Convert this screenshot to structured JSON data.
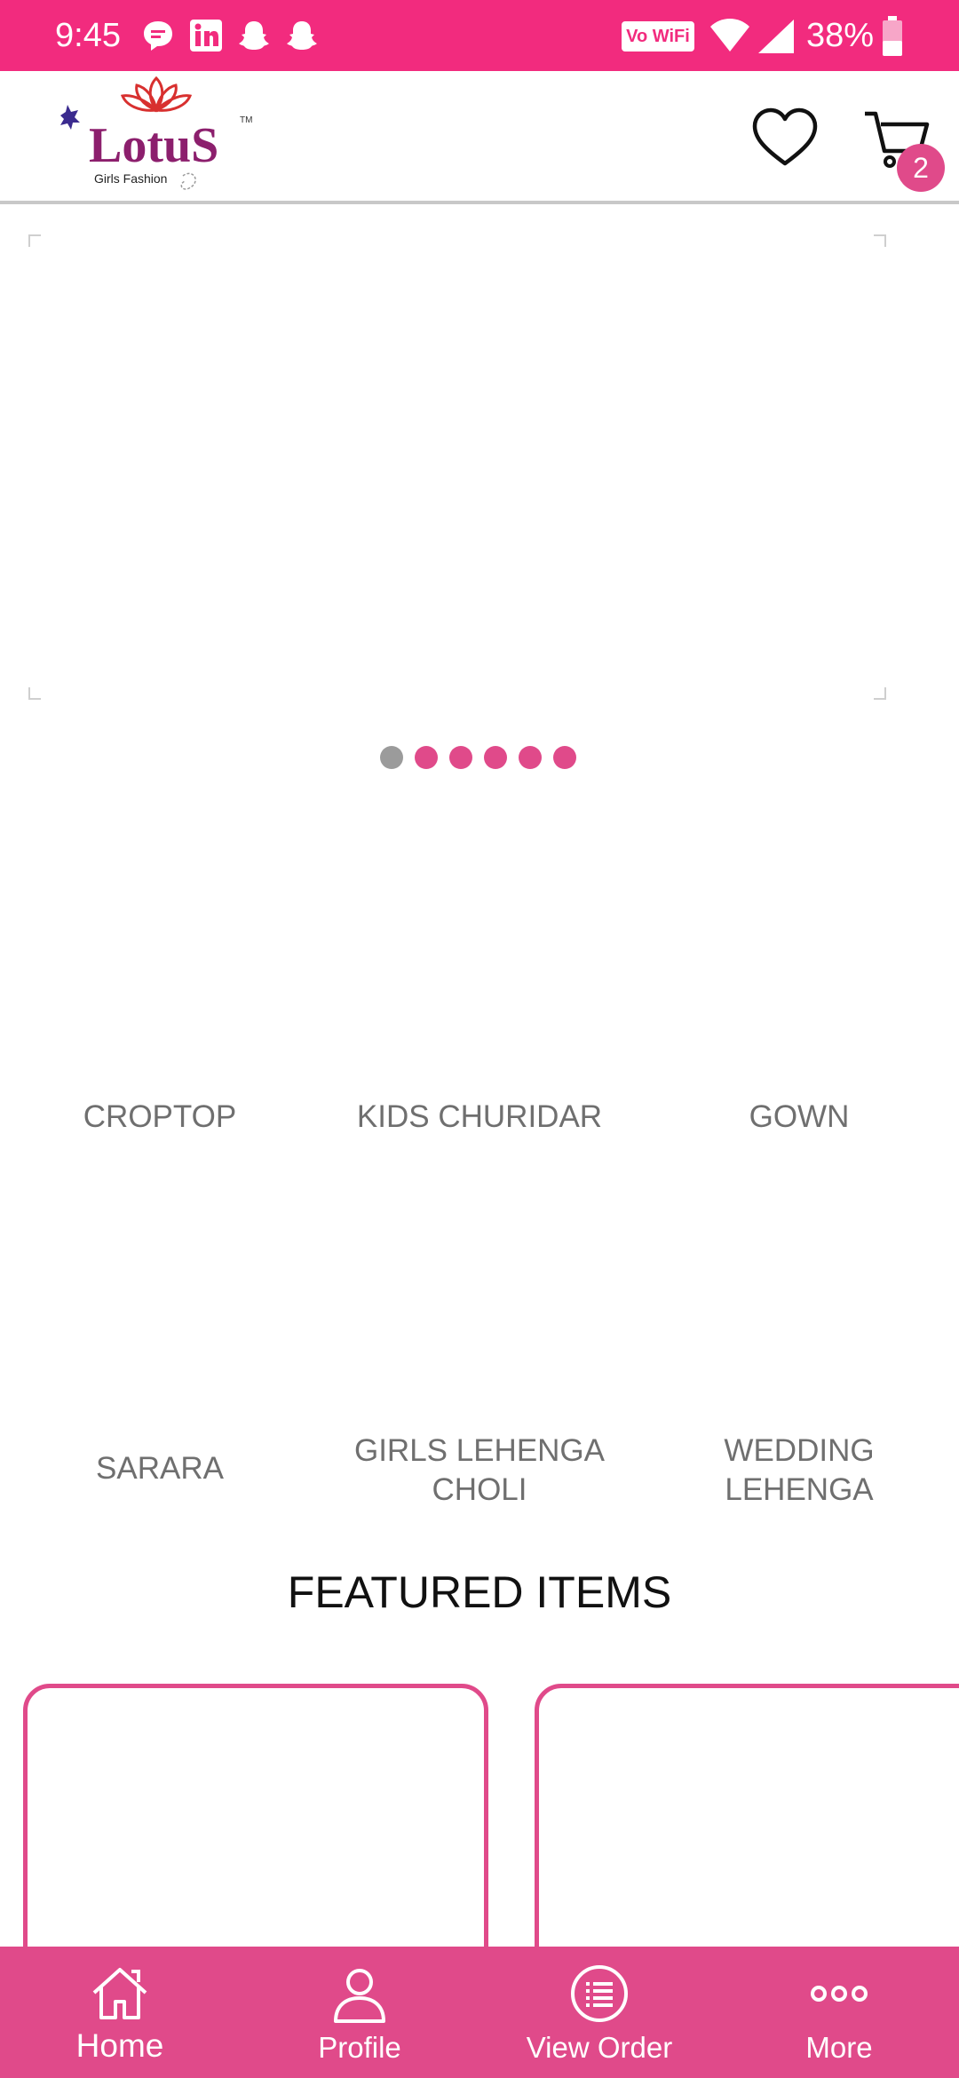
{
  "status_bar": {
    "time": "9:45",
    "network_badge": "Vo WiFi",
    "battery": "38%",
    "icons": [
      "chat-icon",
      "linkedin-icon",
      "snapchat-icon",
      "snapchat-icon",
      "wifi-icon",
      "signal-icon",
      "battery-icon"
    ]
  },
  "header": {
    "brand_name": "LotuS",
    "brand_tagline": "Girls Fashion",
    "cart_count": "2"
  },
  "carousel": {
    "slide_count": 6,
    "active_index": 0
  },
  "categories": [
    {
      "label": "CROPTOP"
    },
    {
      "label": "KIDS CHURIDAR"
    },
    {
      "label": "GOWN"
    },
    {
      "label": "SARARA"
    },
    {
      "label": "GIRLS LEHENGA CHOLI"
    },
    {
      "label": "WEDDING LEHENGA"
    }
  ],
  "featured": {
    "title": "FEATURED ITEMS"
  },
  "bottom_nav": [
    {
      "label": "Home",
      "icon": "home-icon"
    },
    {
      "label": "Profile",
      "icon": "profile-icon"
    },
    {
      "label": "View Order",
      "icon": "order-list-icon"
    },
    {
      "label": "More",
      "icon": "more-icon"
    }
  ],
  "colors": {
    "status_bar": "#f22b7e",
    "accent": "#e04a8a",
    "category_text": "#6f6f6f"
  }
}
